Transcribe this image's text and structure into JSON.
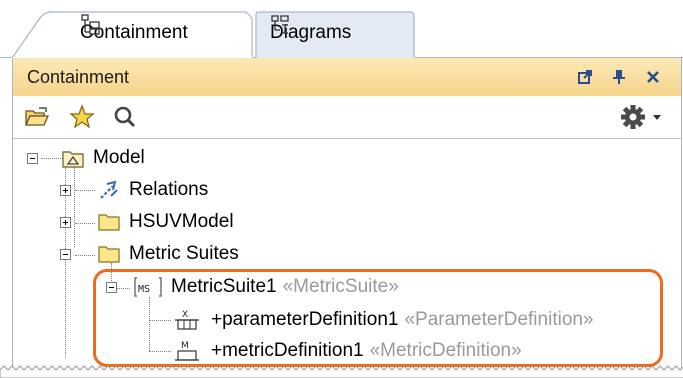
{
  "tabs": [
    {
      "label": "Containment",
      "icon": "containment-tree-icon",
      "active": true
    },
    {
      "label": "Diagrams",
      "icon": "diagrams-icon",
      "active": false
    }
  ],
  "panel": {
    "title": "Containment",
    "header_buttons": [
      "undock-icon",
      "pin-icon",
      "close-icon"
    ],
    "toolbar": [
      "open-folder-icon",
      "star-icon",
      "search-icon",
      "gear-icon"
    ]
  },
  "tree": {
    "nodes": [
      {
        "label": "Model",
        "icon": "model-package-icon",
        "expanded": true
      },
      {
        "label": "Relations",
        "icon": "relations-icon",
        "expanded": false
      },
      {
        "label": "HSUVModel",
        "icon": "folder-icon",
        "expanded": false
      },
      {
        "label": "Metric Suites",
        "icon": "folder-icon",
        "expanded": true
      },
      {
        "label": "MetricSuite1",
        "stereotype": "«MetricSuite»",
        "icon": "metric-suite-icon",
        "expanded": true
      },
      {
        "label": "+parameterDefinition1",
        "stereotype": "«ParameterDefinition»",
        "icon": "parameter-definition-icon"
      },
      {
        "label": "+metricDefinition1",
        "stereotype": "«MetricDefinition»",
        "icon": "metric-definition-icon"
      }
    ]
  },
  "colors": {
    "header": "#f6d48a",
    "highlight": "#ee6a1c",
    "stereotype": "#9a9a9a"
  }
}
